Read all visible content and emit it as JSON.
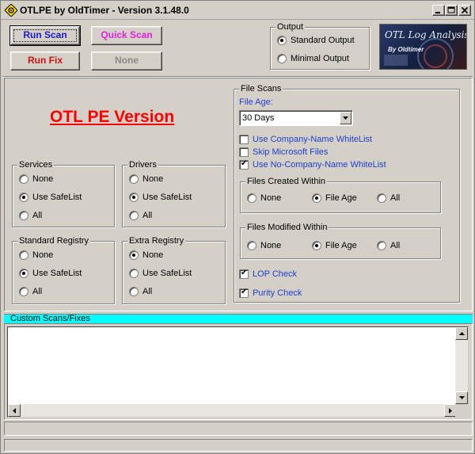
{
  "window": {
    "title": "OTLPE by OldTimer - Version 3.1.48.0"
  },
  "buttons": {
    "run_scan": "Run Scan",
    "quick_scan": "Quick Scan",
    "run_fix": "Run Fix",
    "none": "None"
  },
  "output": {
    "title": "Output",
    "standard": "Standard Output",
    "minimal": "Minimal Output",
    "selected": "standard"
  },
  "logo": {
    "title": "OTL Log Analysis",
    "subtitle": "By Oldtimer"
  },
  "heading": "OTL PE Version",
  "services": {
    "title": "Services",
    "options": [
      "None",
      "Use SafeList",
      "All"
    ],
    "selected": "Use SafeList"
  },
  "drivers": {
    "title": "Drivers",
    "options": [
      "None",
      "Use SafeList",
      "All"
    ],
    "selected": "Use SafeList"
  },
  "standard_registry": {
    "title": "Standard Registry",
    "options": [
      "None",
      "Use SafeList",
      "All"
    ],
    "selected": "Use SafeList"
  },
  "extra_registry": {
    "title": "Extra Registry",
    "options": [
      "None",
      "Use SafeList",
      "All"
    ],
    "selected": "None"
  },
  "file_scans": {
    "title": "File Scans",
    "file_age_label": "File Age:",
    "file_age_value": "30 Days",
    "use_company_whitelist": "Use Company-Name WhiteList",
    "skip_microsoft": "Skip Microsoft Files",
    "use_no_company_whitelist": "Use No-Company-Name WhiteList",
    "checks": {
      "use_company_whitelist": false,
      "skip_microsoft": false,
      "use_no_company_whitelist": true
    }
  },
  "files_created": {
    "title": "Files Created Within",
    "options": [
      "None",
      "File Age",
      "All"
    ],
    "selected": "File Age"
  },
  "files_modified": {
    "title": "Files Modified Within",
    "options": [
      "None",
      "File Age",
      "All"
    ],
    "selected": "File Age"
  },
  "lop_check": {
    "label": "LOP Check",
    "checked": true
  },
  "purity_check": {
    "label": "Purity Check",
    "checked": true
  },
  "custom_scans": {
    "title": "Custom Scans/Fixes",
    "value": ""
  },
  "colors": {
    "face": "#d4d0c8",
    "run_scan": "#1a1ad0",
    "quick_scan": "#e01ee0",
    "run_fix": "#d01010",
    "heading": "#ff0000",
    "label_blue": "#1f3fcf",
    "cyan_header": "#00ffff"
  }
}
